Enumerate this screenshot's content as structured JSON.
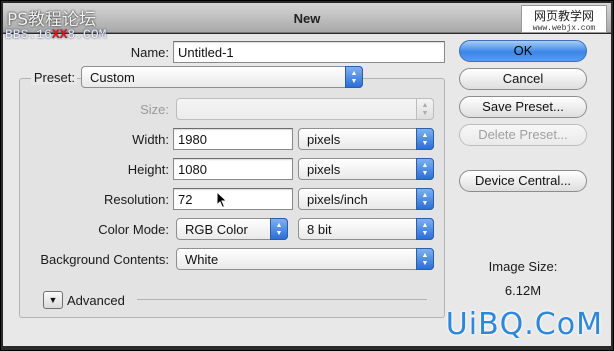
{
  "window": {
    "title": "New"
  },
  "fields": {
    "name_label": "Name:",
    "name_value": "Untitled-1",
    "preset_label": "Preset:",
    "preset_value": "Custom",
    "size_label": "Size:",
    "size_value": "",
    "width_label": "Width:",
    "width_value": "1980",
    "width_unit": "pixels",
    "height_label": "Height:",
    "height_value": "1080",
    "height_unit": "pixels",
    "resolution_label": "Resolution:",
    "resolution_value": "72",
    "resolution_unit": "pixels/inch",
    "color_mode_label": "Color Mode:",
    "color_mode_value": "RGB Color",
    "bit_depth_value": "8 bit",
    "background_label": "Background Contents:",
    "background_value": "White",
    "advanced_label": "Advanced"
  },
  "buttons": {
    "ok": "OK",
    "cancel": "Cancel",
    "save_preset": "Save Preset...",
    "delete_preset": "Delete Preset...",
    "device_central": "Device Central..."
  },
  "image_size": {
    "label": "Image Size:",
    "value": "6.12M"
  },
  "watermarks": {
    "top_left_line1": "PS教程论坛",
    "top_left_line2_a": "BBS.16",
    "top_left_line2_x": "XX",
    "top_left_line2_b": "8.COM",
    "top_right_line1": "网页教学网",
    "top_right_line2": "www.webjx.com",
    "bottom_right": "UiBQ.CoM"
  },
  "icons": {
    "popup_arrows": "updown-arrows-icon",
    "disclosure": "disclosure-triangle-icon",
    "cursor": "mouse-pointer-icon"
  },
  "colors": {
    "accent": "#3a86e8",
    "dialog_bg": "#e8e8e8",
    "watermark_blue": "#2d88d9",
    "watermark_red": "#e01414"
  }
}
